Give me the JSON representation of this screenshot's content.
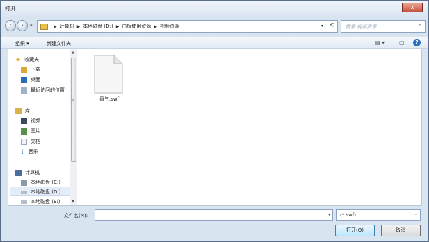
{
  "window": {
    "title": "打开",
    "close_label": "x"
  },
  "breadcrumb": [
    "计算机",
    "本地磁盘 (D:)",
    "白板使用资源",
    "视频资源"
  ],
  "search": {
    "placeholder": "搜索 视频资源"
  },
  "toolbar": {
    "organize_label": "组织 ▾",
    "new_folder_label": "新建文件夹"
  },
  "sidebar": {
    "favorites_header": "收藏夹",
    "favorites": [
      "下载",
      "桌面",
      "最近访问的位置"
    ],
    "library_header": "库",
    "library": [
      "视频",
      "图片",
      "文档",
      "音乐"
    ],
    "computer_header": "计算机",
    "drives": [
      "本地磁盘 (C:)",
      "本地磁盘 (D:)",
      "本地磁盘 (E:)"
    ]
  },
  "files": [
    {
      "name": "番气.swf",
      "icon": "file-icon"
    }
  ],
  "bottom": {
    "filename_label": "文件名(N):",
    "filename_value": "",
    "filter_value": "(*.swf)",
    "open_label": "打开(O)",
    "cancel_label": "取消"
  },
  "colors": {
    "accent": "#2a6fc1",
    "close": "#c7523c",
    "folder": "#e8c04d"
  }
}
